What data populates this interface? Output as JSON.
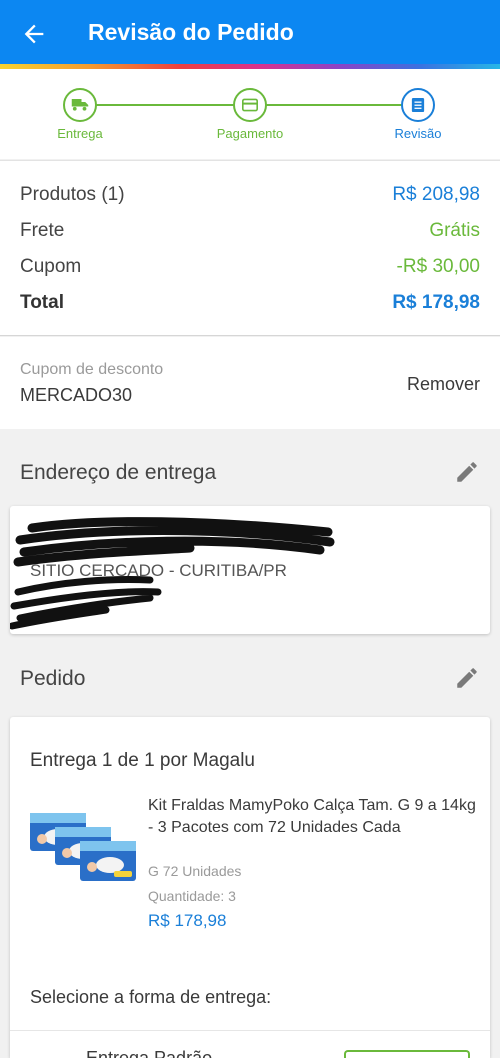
{
  "header": {
    "title": "Revisão do Pedido",
    "back_icon": "arrow-left-icon"
  },
  "colors": {
    "primary": "#0c87f2",
    "step_done": "#6ab93b",
    "step_active": "#1a7fd8",
    "price": "#1a7fd8",
    "free": "#6ab93b"
  },
  "stepper": {
    "steps": [
      {
        "label": "Entrega",
        "icon": "truck-icon",
        "state": "done"
      },
      {
        "label": "Pagamento",
        "icon": "card-icon",
        "state": "done"
      },
      {
        "label": "Revisão",
        "icon": "document-icon",
        "state": "active"
      }
    ]
  },
  "summary": {
    "rows": [
      {
        "label": "Produtos (1)",
        "value": "R$ 208,98"
      },
      {
        "label": "Frete",
        "value": "Grátis"
      },
      {
        "label": "Cupom",
        "value": "-R$ 30,00"
      },
      {
        "label": "Total",
        "value": "R$ 178,98"
      }
    ]
  },
  "coupon": {
    "caption": "Cupom de desconto",
    "code": "MERCADO30",
    "remove_label": "Remover"
  },
  "address": {
    "title": "Endereço de entrega",
    "line2": "SITIO CERCADO - CURITIBA/PR"
  },
  "order": {
    "title": "Pedido",
    "shipment": "Entrega 1 de 1 por Magalu",
    "product": {
      "name": "Kit Fraldas MamyPoko Calça Tam. G 9 a 14kg - 3 Pacotes com 72 Unidades Cada",
      "variant": "G 72 Unidades",
      "quantity": "Quantidade:  3",
      "price": "R$ 178,98"
    },
    "delivery_prompt": "Selecione a forma de entrega:",
    "delivery_option": "Entrega Padrão"
  }
}
